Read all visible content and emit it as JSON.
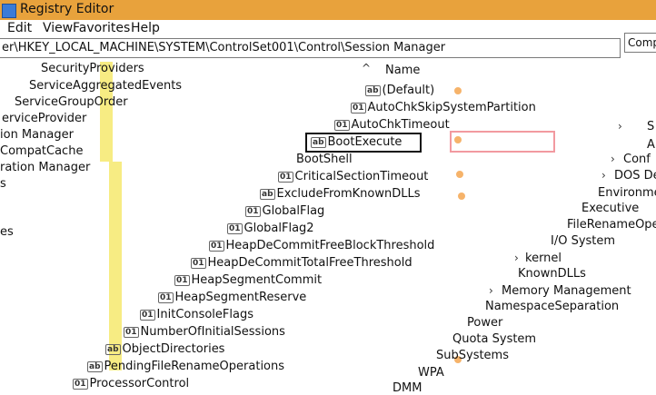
{
  "window": {
    "title": "Registry Editor"
  },
  "menu": [
    "Edit",
    "View",
    "Favorites",
    "Help"
  ],
  "address": {
    "path": "er\\HKEY_LOCAL_MACHINE\\SYSTEM\\ControlSet001\\Control\\Session Manager"
  },
  "right_box": {
    "text": "Compu"
  },
  "tree": [
    "SecurityProviders",
    "ServiceAggregatedEvents",
    "ServiceGroupOrder",
    "erviceProvider",
    "ion Manager",
    "CompatCache",
    "ration Manager",
    "s",
    "es"
  ],
  "values_header": "Name",
  "values": [
    "(Default)",
    "AutoChkSkipSystemPartition",
    "AutoChkTimeout",
    "BootExecute",
    "BootShell",
    "CriticalSectionTimeout",
    "ExcludeFromKnownDLLs",
    "GlobalFlag",
    "GlobalFlag2",
    "HeapDeCommitFreeBlockThreshold",
    "HeapDeCommitTotalFreeThreshold",
    "HeapSegmentCommit",
    "HeapSegmentReserve",
    "InitConsoleFlags",
    "NumberOfInitialSessions",
    "ObjectDirectories",
    "PendingFileRenameOperations",
    "ProcessorControl"
  ],
  "right_tree": [
    "S",
    "A",
    "Conf",
    "DOS De",
    "Environment",
    "Executive",
    "FileRenameOpera",
    "I/O System",
    "kernel",
    "KnownDLLs",
    "Memory Management",
    "NamespaceSeparation",
    "Power",
    "Quota System",
    "SubSystems",
    "WPA",
    "DMM"
  ]
}
